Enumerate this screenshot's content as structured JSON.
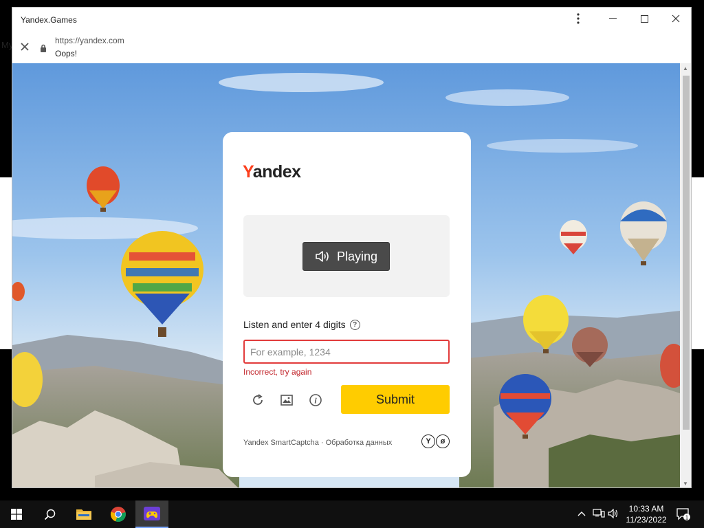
{
  "desktop": {
    "partial_text": "My"
  },
  "window": {
    "title": "Yandex.Games",
    "url": "https://yandex.com",
    "page_subtitle": "Oops!"
  },
  "captcha": {
    "logo": {
      "first_letter": "Y",
      "rest": "andex"
    },
    "play_label": "Playing",
    "instruction": "Listen and enter 4 digits",
    "help_glyph": "?",
    "input_placeholder": "For example, 1234",
    "input_value": "",
    "error": "Incorrect, try again",
    "submit_label": "Submit",
    "footer": "Yandex SmartCaptcha · Обработка данных",
    "info_glyph": "i",
    "badge_y": "Y",
    "badge_leaf": "ø"
  },
  "taskbar": {
    "time": "10:33 AM",
    "date": "11/23/2022",
    "notification_count": "1"
  },
  "colors": {
    "yandex_red": "#fc3f1d",
    "submit_yellow": "#ffcc00",
    "error_red": "#c2272d"
  }
}
